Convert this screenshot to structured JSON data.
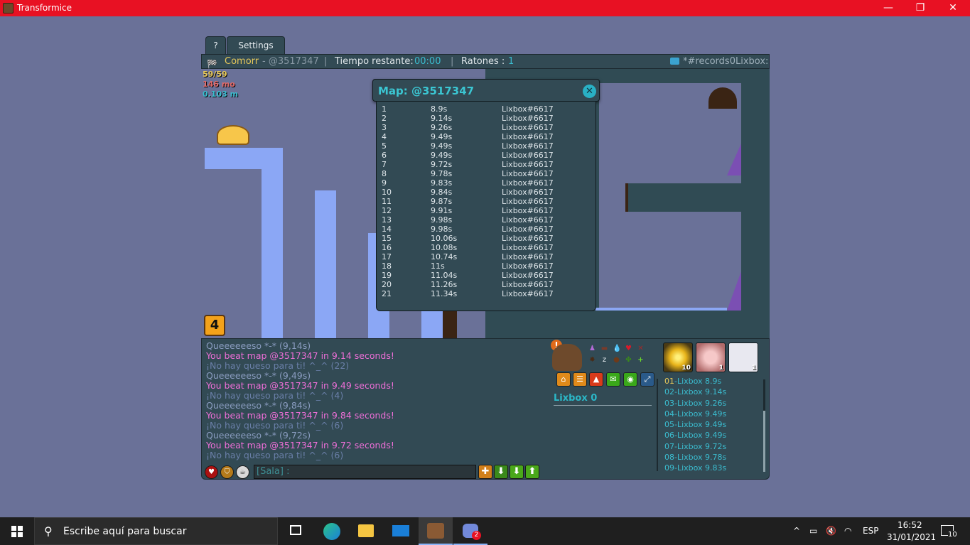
{
  "window": {
    "title": "Transformice",
    "minimize": "—",
    "restore": "❐",
    "close": "✕"
  },
  "tabs": {
    "help": "?",
    "settings": "Settings"
  },
  "infobar": {
    "player": "Comorr",
    "map_code": "- @3517347",
    "sep1": "|",
    "time_label": "Tiempo restante:",
    "time_value": "00:00",
    "sep2": "|",
    "mice_label": "Ratones :",
    "mice_value": "1",
    "room": "*#records0Lixbox:"
  },
  "stats": {
    "fps": "59/59",
    "memory": "146 mo",
    "ping": "0.103 m"
  },
  "colors": {
    "accent": "#3bc6d2",
    "panel": "#324a54",
    "map_bg": "#6a7198",
    "ground": "#8ba7f5",
    "pink": "#ee6fd8",
    "title_bar": "#e81123"
  },
  "round_counter": "4",
  "popup": {
    "title": "Map: @3517347",
    "close_icon": "✕",
    "records": [
      {
        "pos": "1",
        "time": "8.9s",
        "player": "Lixbox#6617"
      },
      {
        "pos": "2",
        "time": "9.14s",
        "player": "Lixbox#6617"
      },
      {
        "pos": "3",
        "time": "9.26s",
        "player": "Lixbox#6617"
      },
      {
        "pos": "4",
        "time": "9.49s",
        "player": "Lixbox#6617"
      },
      {
        "pos": "5",
        "time": "9.49s",
        "player": "Lixbox#6617"
      },
      {
        "pos": "6",
        "time": "9.49s",
        "player": "Lixbox#6617"
      },
      {
        "pos": "7",
        "time": "9.72s",
        "player": "Lixbox#6617"
      },
      {
        "pos": "8",
        "time": "9.78s",
        "player": "Lixbox#6617"
      },
      {
        "pos": "9",
        "time": "9.83s",
        "player": "Lixbox#6617"
      },
      {
        "pos": "10",
        "time": "9.84s",
        "player": "Lixbox#6617"
      },
      {
        "pos": "11",
        "time": "9.87s",
        "player": "Lixbox#6617"
      },
      {
        "pos": "12",
        "time": "9.91s",
        "player": "Lixbox#6617"
      },
      {
        "pos": "13",
        "time": "9.98s",
        "player": "Lixbox#6617"
      },
      {
        "pos": "14",
        "time": "9.98s",
        "player": "Lixbox#6617"
      },
      {
        "pos": "15",
        "time": "10.06s",
        "player": "Lixbox#6617"
      },
      {
        "pos": "16",
        "time": "10.08s",
        "player": "Lixbox#6617"
      },
      {
        "pos": "17",
        "time": "10.74s",
        "player": "Lixbox#6617"
      },
      {
        "pos": "18",
        "time": "11s",
        "player": "Lixbox#6617"
      },
      {
        "pos": "19",
        "time": "11.04s",
        "player": "Lixbox#6617"
      },
      {
        "pos": "20",
        "time": "11.26s",
        "player": "Lixbox#6617"
      },
      {
        "pos": "21",
        "time": "11.34s",
        "player": "Lixbox#6617"
      }
    ]
  },
  "chat": [
    {
      "text": "Queeeeeeso *-* (9,14s)",
      "color": "#8a9cc0"
    },
    {
      "text": "You beat map @3517347 in 9.14 seconds!",
      "color": "#ee6fd8"
    },
    {
      "text": " ¡No hay queso para ti! ^_^ (22)",
      "color": "#6a7fa8"
    },
    {
      "text": "Queeeeeeso *-* (9,49s)",
      "color": "#8a9cc0"
    },
    {
      "text": "You beat map @3517347 in 9.49 seconds!",
      "color": "#ee6fd8"
    },
    {
      "text": " ¡No hay queso para ti! ^_^ (4)",
      "color": "#6a7fa8"
    },
    {
      "text": "Queeeeeeso *-* (9,84s)",
      "color": "#8a9cc0"
    },
    {
      "text": "You beat map @3517347 in 9.84 seconds!",
      "color": "#ee6fd8"
    },
    {
      "text": " ¡No hay queso para ti! ^_^ (6)",
      "color": "#6a7fa8"
    },
    {
      "text": "Queeeeeeso *-* (9,72s)",
      "color": "#8a9cc0"
    },
    {
      "text": "You beat map @3517347 in 9.72 seconds!",
      "color": "#ee6fd8"
    },
    {
      "text": " ¡No hay queso para ti! ^_^ (6)",
      "color": "#6a7fa8"
    }
  ],
  "chat_input": {
    "value": "[Sala] :"
  },
  "player_panel": {
    "name": "Lixbox 0"
  },
  "avatars": [
    {
      "count": "10"
    },
    {
      "count": "1"
    },
    {
      "count": "1"
    }
  ],
  "ranking": [
    {
      "num": "01",
      "entry": "-Lixbox 8.9s",
      "num_color": "#e6c85a"
    },
    {
      "num": "02",
      "entry": "-Lixbox 9.14s",
      "num_color": "#3bbdd0"
    },
    {
      "num": "03",
      "entry": "-Lixbox 9.26s",
      "num_color": "#3bbdd0"
    },
    {
      "num": "04",
      "entry": "-Lixbox 9.49s",
      "num_color": "#3bbdd0"
    },
    {
      "num": "05",
      "entry": "-Lixbox 9.49s",
      "num_color": "#3bbdd0"
    },
    {
      "num": "06",
      "entry": "-Lixbox 9.49s",
      "num_color": "#3bbdd0"
    },
    {
      "num": "07",
      "entry": "-Lixbox 9.72s",
      "num_color": "#3bbdd0"
    },
    {
      "num": "08",
      "entry": "-Lixbox 9.78s",
      "num_color": "#3bbdd0"
    },
    {
      "num": "09",
      "entry": "-Lixbox 9.83s",
      "num_color": "#3bbdd0"
    }
  ],
  "taskbar": {
    "search_placeholder": "Escribe aquí para buscar",
    "discord_badge": "2",
    "language": "ESP",
    "time": "16:52",
    "date": "31/01/2021",
    "notifications": "10"
  }
}
